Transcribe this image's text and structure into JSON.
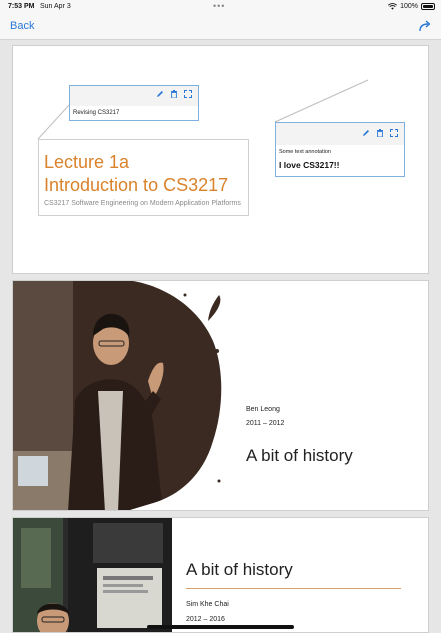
{
  "statusbar": {
    "time": "7:53 PM",
    "date": "Sun Apr 3",
    "dots": "•••",
    "battery": "100%"
  },
  "navbar": {
    "back_label": "Back",
    "share_icon": "share-icon"
  },
  "slide1": {
    "title_line1": "Lecture 1a",
    "title_line2": "Introduction to CS3217",
    "subtitle": "CS3217 Software Engineering on Modern Application Platforms",
    "annotation1_text": "Revising CS3217",
    "annotation2_small": "Some text annotation",
    "annotation2_big": "I love CS3217!!"
  },
  "slide2": {
    "name": "Ben Leong",
    "years": "2011 – 2012",
    "title": "A bit of history"
  },
  "slide3": {
    "title": "A bit of history",
    "name": "Sim Khe Chai",
    "years": "2012 – 2016"
  },
  "colors": {
    "accent": "#2a78d6",
    "title_orange": "#d9822b",
    "annotation_border": "#7fb0de"
  }
}
